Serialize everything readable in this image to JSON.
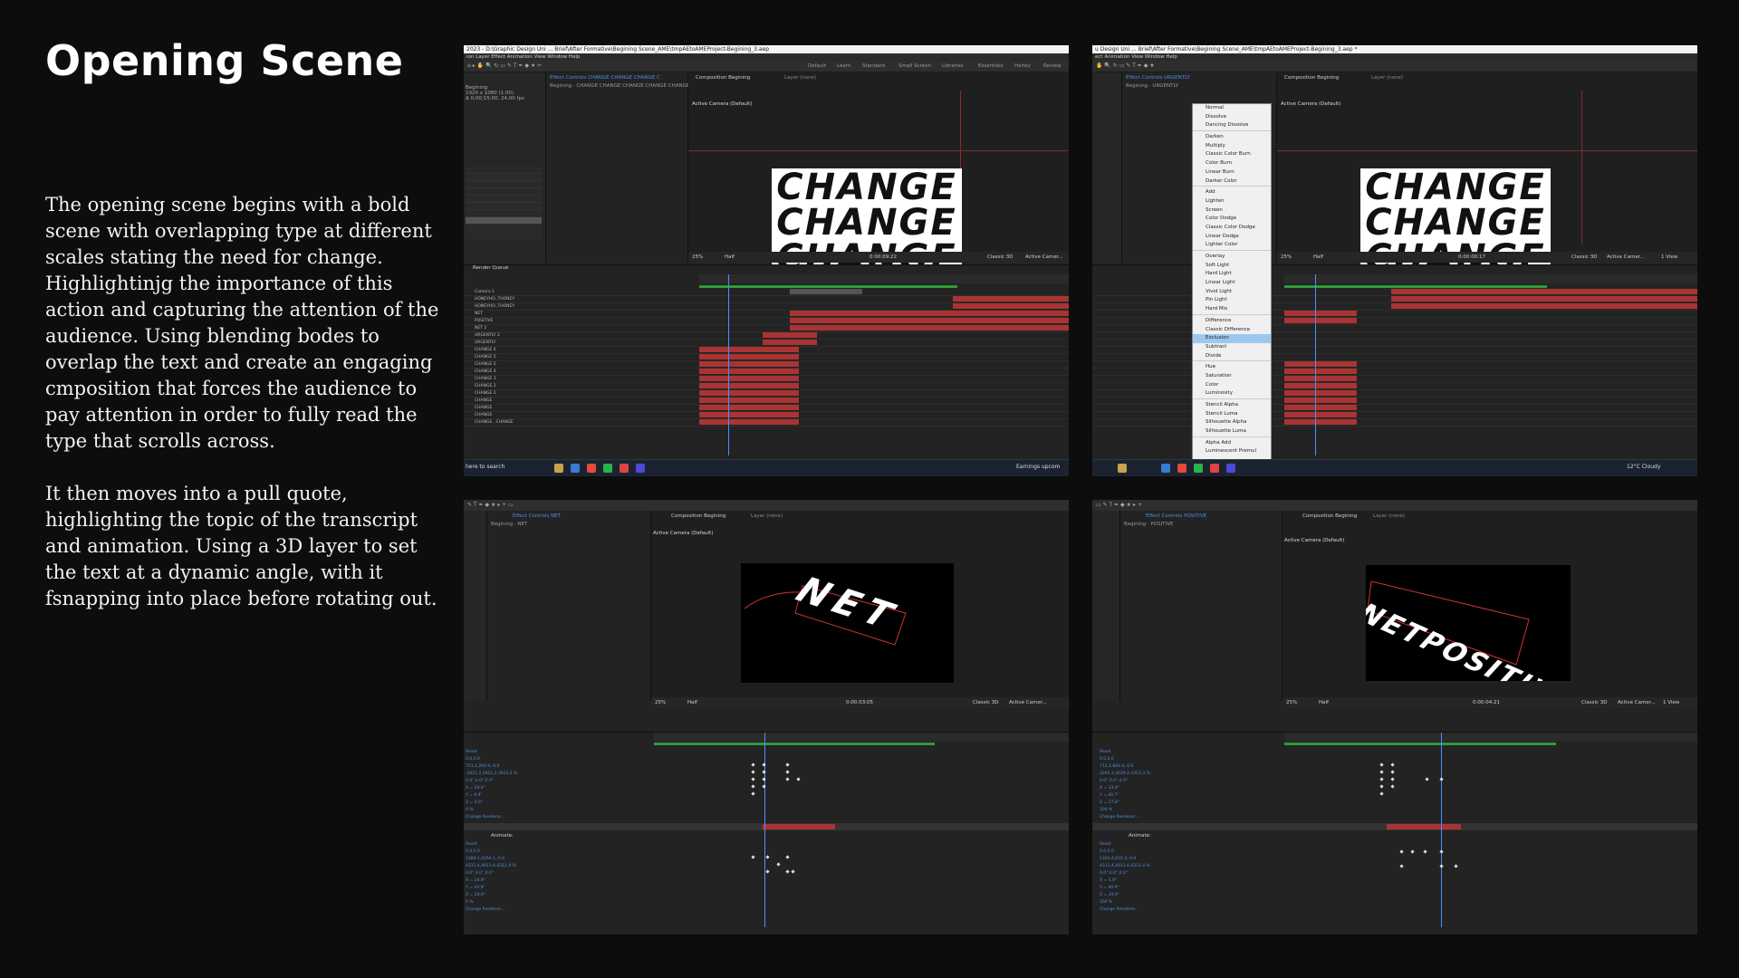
{
  "page": {
    "title": "Opening Scene",
    "paragraphs": [
      "The opening scene begins with a bold scene with overlapping type at different scales stating the need for change. Highlightinjg the importance of this action and capturing the attention of the audience. Using blending bodes to overlap the text and create an engaging cmposition that forces the audience to pay attention in order to fully read the type that scrolls across.",
      "It then moves into a pull quote, highlighting the topic of the transcript and animation. Using a 3D layer to set the text at a dynamic angle, with it fsnapping into place before rotating out."
    ]
  },
  "screenshots": {
    "s1": {
      "titlebar": "2023 - D:\\Graphic Design Uni ... Brief\\After Formative\\Begining Scene_AME\\tmpAEtoAMEProject-Begining_3.aep",
      "menu": "ion   Layer   Effect   Animation   View   Window   Help",
      "workspaces": [
        "Default",
        "Learn",
        "Standard",
        "Small Screen",
        "Libraries",
        "Essentials",
        "Harley",
        "Review"
      ],
      "effect_tab": "Effect Controls CHANGE CHANGE CHANGE C",
      "comp_tab": "Composition Begining",
      "layer_tab": "Layer (none)",
      "breadcrumb": "Begining · CHANGE CHANGE CHANGE CHANGE CHANGE CHANGE CH",
      "camera": "Active Camera (Default)",
      "canvas_word": "CHANGE",
      "zoom": "25%",
      "resolution": "Half",
      "timecode": "0:00:09:22",
      "renderer": "Classic 3D",
      "camera_select": "Active Camer...",
      "render_queue": "Render Queue",
      "project_info": "Begining\n1920 x 1080 (1.00)\nΔ 0;00;15;00, 24.00 fps",
      "layers": [
        "Camera 1",
        "HONEYHO..THONEY",
        "HONEYHO..THONEY",
        "NET",
        "POSITIVE",
        "NET 2",
        "URGENTLY 2",
        "URGENTLY",
        "CHANGE 6",
        "CHANGE 5",
        "CHANGE 5",
        "CHANGE 4",
        "CHANGE 3",
        "CHANGE 2",
        "CHANGE 2",
        "CHANGE",
        "CHANGE",
        "CHANGE",
        "CHANGE ..CHANGE"
      ],
      "search": "here to search",
      "notification": "Earnings upcom"
    },
    "s2": {
      "titlebar": "u Design Uni ... Brief\\After Formative\\Begining Scene_AME\\tmpAEtoAMEProject-Begining_3.aep *",
      "menu": "ect   Animation   View   Window   Help",
      "effect_tab": "Effect Controls URGENTLY",
      "comp_tab": "Composition Begining",
      "layer_tab": "Layer (none)",
      "breadcrumb": "Begining · URGENTLY",
      "camera": "Active Camera (Default)",
      "canvas_word": "CHANGE",
      "zoom": "25%",
      "resolution": "Half",
      "timecode": "0:00:00:17",
      "renderer": "Classic 3D",
      "camera_select": "Active Camer...",
      "view": "1 View",
      "weather": "12°C  Cloudy",
      "blend_modes": [
        "Normal",
        "Dissolve",
        "Dancing Dissolve",
        "",
        "Darken",
        "Multiply",
        "Classic Color Burn",
        "Color Burn",
        "Linear Burn",
        "Darker Color",
        "",
        "Add",
        "Lighten",
        "Screen",
        "Color Dodge",
        "Classic Color Dodge",
        "Linear Dodge",
        "Lighter Color",
        "",
        "Overlay",
        "Soft Light",
        "Hard Light",
        "Linear Light",
        "Vivid Light",
        "Pin Light",
        "Hard Mix",
        "",
        "Difference",
        "Classic Difference",
        "Exclusion",
        "Subtract",
        "Divide",
        "",
        "Hue",
        "Saturation",
        "Color",
        "Luminosity",
        "",
        "Stencil Alpha",
        "Stencil Luma",
        "Silhouette Alpha",
        "Silhouette Luma",
        "",
        "Alpha Add",
        "Luminescent Premul"
      ],
      "selected_mode": "Exclusion"
    },
    "s3": {
      "effect_tab": "Effect Controls NET",
      "comp_tab": "Composition Begining",
      "layer_tab": "Layer (none)",
      "breadcrumb": "Begining · NET",
      "camera": "Active Camera (Default)",
      "canvas_word": "NET",
      "zoom": "25%",
      "resolution": "Half",
      "timecode": "0:00:03:05",
      "renderer": "Classic 3D",
      "camera_select": "Active Camer...",
      "params_a": [
        "Reset",
        "0.0,0.0",
        "753.2,269.9,-0.0",
        "-3621.2,3921.2,3621.2 %",
        "0.0°,0.0°,0.0°",
        "X = 29.4°",
        "Y = 9.9°",
        "Z = 9.9°",
        "0 %",
        "Change Renderer..."
      ],
      "params_b": [
        "Reset",
        "0.0,0.0",
        "1089.1,4264.1,-0.0",
        "4311.4,4911.4,4311.4 %",
        "0.0°,0.0°,0.0°",
        "X = 24.9°",
        "Y = 44.9°",
        "Z = 29.9°",
        "0 %",
        "Change Renderer..."
      ],
      "animate": "Animate:"
    },
    "s4": {
      "effect_tab": "Effect Controls POSITIVE",
      "comp_tab": "Composition Begining",
      "layer_tab": "Layer (none)",
      "breadcrumb": "Begining · POSITIVE",
      "camera": "Active Camera (Default)",
      "canvas_word": "NETPOSITIVE",
      "zoom": "25%",
      "resolution": "Half",
      "timecode": "0:00:04:21",
      "renderer": "Classic 3D",
      "camera_select": "Active Camer...",
      "view": "1 View",
      "params_a": [
        "Reset",
        "0.0,0.0",
        "712.2,844.4,-0.0",
        "3262.3,3619.2,3353.3 %",
        "0.0°,0.0°,0.0°",
        "X = 33.9°",
        "Y = 40.7°",
        "Z = 27.8°",
        "100 %",
        "Change Renderer..."
      ],
      "params_b": [
        "Reset",
        "0.0,0.0",
        "1303.4,615.4,-0.0",
        "4311.4,4911.4,4311.4 %",
        "0.0°,0.0°,0.0°",
        "X = 5.9°",
        "Y = 40.9°",
        "Z = 29.9°",
        "100 %",
        "Change Renderer..."
      ],
      "animate": "Animate:"
    }
  }
}
